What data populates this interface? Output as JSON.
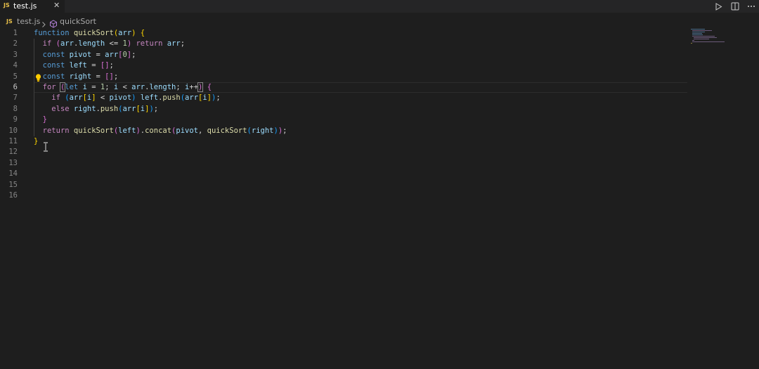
{
  "tab": {
    "lang_badge": "JS",
    "label": "test.js",
    "close": "✕"
  },
  "actions": [
    {
      "name": "run-icon"
    },
    {
      "name": "split-editor-icon"
    },
    {
      "name": "more-actions-icon"
    }
  ],
  "breadcrumb": {
    "lang_badge": "JS",
    "file": "test.js",
    "symbol": "quickSort",
    "symbol_icon": "cube-icon",
    "separator_icon": "chevron-right-icon"
  },
  "editor": {
    "active_line": 6,
    "line_numbers": [
      "1",
      "2",
      "3",
      "4",
      "5",
      "6",
      "7",
      "8",
      "9",
      "10",
      "11",
      "12",
      "13",
      "14",
      "15",
      "16"
    ],
    "lines": [
      "function quickSort(arr) {",
      "  if (arr.length <= 1) return arr;",
      "  const pivot = arr[0];",
      "  const left = [];",
      "  const right = [];",
      "  for (let i = 1; i < arr.length; i++) {",
      "    if (arr[i] < pivot) left.push(arr[i]);",
      "    else right.push(arr[i]);",
      "  }",
      "  return quickSort(left).concat(pivot, quickSort(right));",
      "}",
      "",
      "",
      "",
      "",
      ""
    ]
  },
  "icons": {
    "lightbulb": "lightbulb-icon",
    "cursor": "text-cursor-icon"
  },
  "colors": {
    "background": "#1e1e1e",
    "keyword": "#569cd6",
    "control": "#c586c0",
    "function": "#dcdcaa",
    "variable": "#9cdcfe",
    "number": "#b5cea8"
  }
}
